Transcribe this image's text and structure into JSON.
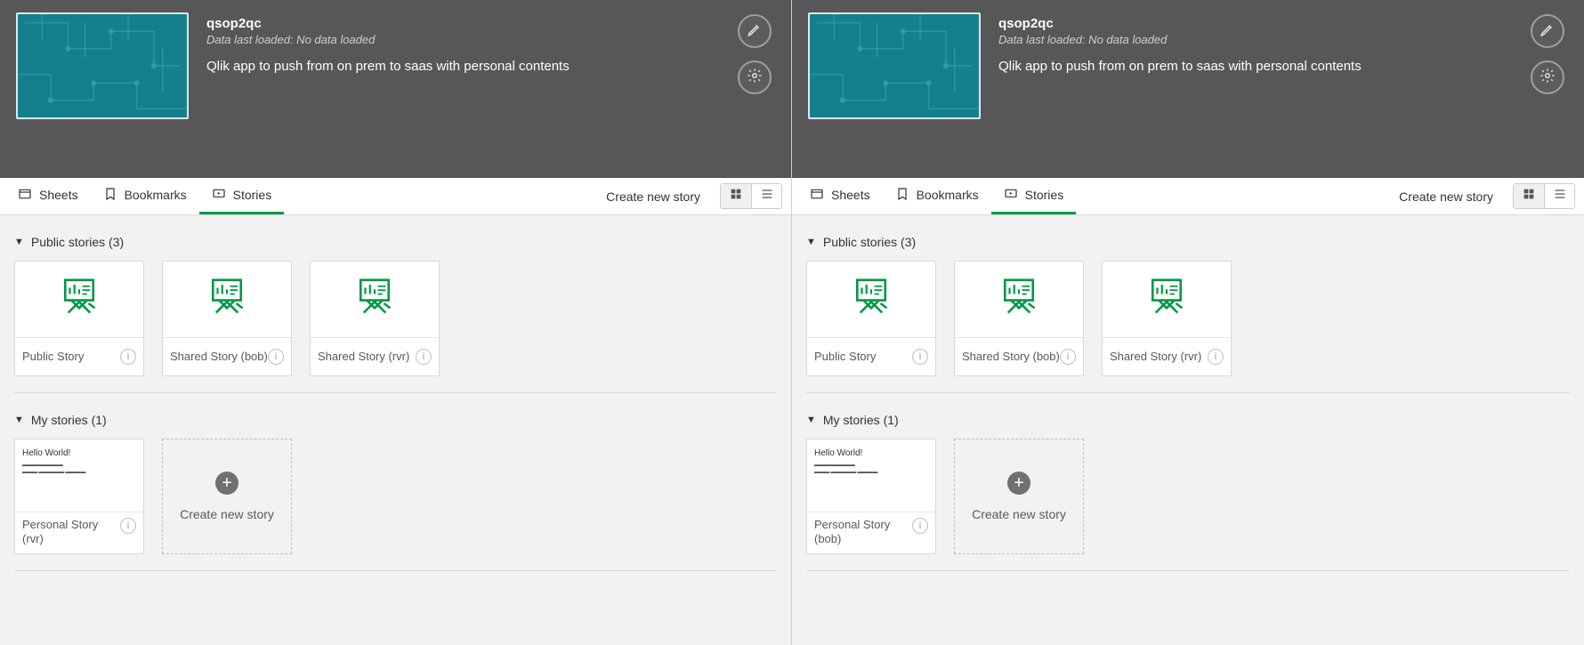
{
  "panes": [
    {
      "app": {
        "title": "qsop2qc",
        "subtitle": "Data last loaded: No data loaded",
        "description": "Qlik app to push from on prem to saas with personal contents"
      },
      "tabs": {
        "sheets": "Sheets",
        "bookmarks": "Bookmarks",
        "stories": "Stories",
        "active": "stories"
      },
      "toolbar": {
        "create": "Create new story"
      },
      "sections": [
        {
          "title": "Public stories (3)",
          "cards": [
            {
              "kind": "story",
              "title": "Public Story"
            },
            {
              "kind": "story",
              "title": "Shared Story (bob)"
            },
            {
              "kind": "story",
              "title": "Shared Story (rvr)"
            }
          ]
        },
        {
          "title": "My stories (1)",
          "cards": [
            {
              "kind": "personal",
              "title": "Personal Story (rvr)",
              "thumb_title": "Hello World!"
            },
            {
              "kind": "placeholder",
              "title": "Create new story"
            }
          ]
        }
      ]
    },
    {
      "app": {
        "title": "qsop2qc",
        "subtitle": "Data last loaded: No data loaded",
        "description": "Qlik app to push from on prem to saas with personal contents"
      },
      "tabs": {
        "sheets": "Sheets",
        "bookmarks": "Bookmarks",
        "stories": "Stories",
        "active": "stories"
      },
      "toolbar": {
        "create": "Create new story"
      },
      "sections": [
        {
          "title": "Public stories (3)",
          "cards": [
            {
              "kind": "story",
              "title": "Public Story"
            },
            {
              "kind": "story",
              "title": "Shared Story (bob)"
            },
            {
              "kind": "story",
              "title": "Shared Story (rvr)"
            }
          ]
        },
        {
          "title": "My stories (1)",
          "cards": [
            {
              "kind": "personal",
              "title": "Personal Story (bob)",
              "thumb_title": "Hello World!"
            },
            {
              "kind": "placeholder",
              "title": "Create new story"
            }
          ]
        }
      ]
    }
  ]
}
